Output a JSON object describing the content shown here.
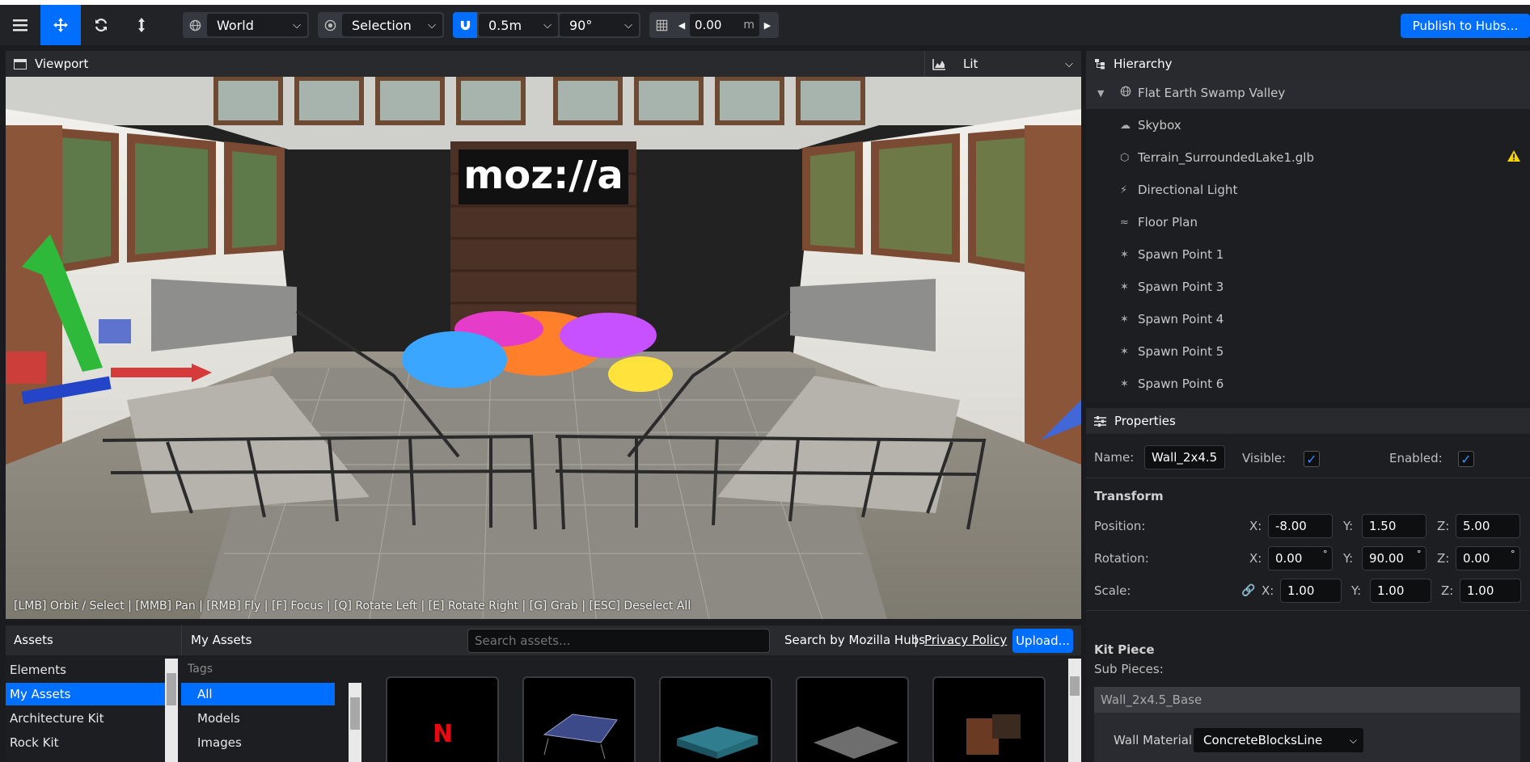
{
  "toolbar": {
    "coordinate_space": "World",
    "pivot_mode": "Selection",
    "snap_translate": "0.5m",
    "snap_rotate": "90°",
    "grid_height": "0.00",
    "grid_unit": "m",
    "publish_label": "Publish to Hubs..."
  },
  "viewport": {
    "title": "Viewport",
    "render_mode": "Lit",
    "logo_text": "moz://a",
    "hint": "[LMB] Orbit / Select | [MMB] Pan | [RMB] Fly | [F] Focus | [Q] Rotate Left | [E] Rotate Right | [G] Grab | [ESC] Deselect All"
  },
  "hierarchy": {
    "title": "Hierarchy",
    "items": [
      {
        "label": "Flat Earth Swamp Valley",
        "icon": "globe-icon"
      },
      {
        "label": "Skybox",
        "icon": "cloud-icon"
      },
      {
        "label": "Terrain_SurroundedLake1.glb",
        "icon": "cube-icon"
      },
      {
        "label": "Directional Light",
        "icon": "bolt-icon"
      },
      {
        "label": "Floor Plan",
        "icon": "shoe-prints-icon"
      },
      {
        "label": "Spawn Point 1",
        "icon": "street-view-icon"
      },
      {
        "label": "Spawn Point 3",
        "icon": "street-view-icon"
      },
      {
        "label": "Spawn Point 4",
        "icon": "street-view-icon"
      },
      {
        "label": "Spawn Point 5",
        "icon": "street-view-icon"
      },
      {
        "label": "Spawn Point 6",
        "icon": "street-view-icon"
      }
    ]
  },
  "properties": {
    "title": "Properties",
    "name_label": "Name:",
    "name_value": "Wall_2x4.5",
    "visible_label": "Visible:",
    "enabled_label": "Enabled:",
    "transform_title": "Transform",
    "position_label": "Position:",
    "rotation_label": "Rotation:",
    "scale_label": "Scale:",
    "x_label": "X:",
    "y_label": "Y:",
    "z_label": "Z:",
    "position": {
      "x": "-8.00",
      "y": "1.50",
      "z": "5.00"
    },
    "rotation": {
      "x": "0.00",
      "y": "90.00",
      "z": "0.00"
    },
    "scale": {
      "x": "1.00",
      "y": "1.00",
      "z": "1.00"
    },
    "kit_piece_title": "Kit Piece",
    "sub_pieces_label": "Sub Pieces:",
    "sub_piece": "Wall_2x4.5_Base",
    "wall_material_label": "Wall Material",
    "wall_material_value": "ConcreteBlocksLine"
  },
  "assets": {
    "title": "Assets",
    "section_title": "My Assets",
    "search_placeholder": "Search assets...",
    "search_by": "Search by Mozilla Hubs",
    "separator": "|",
    "privacy": "Privacy Policy",
    "upload": "Upload...",
    "categories": [
      "Elements",
      "My Assets",
      "Architecture Kit",
      "Rock Kit"
    ],
    "tags_title": "Tags",
    "tags": [
      "All",
      "Models",
      "Images"
    ],
    "thumb_logo": "N"
  },
  "colors": {
    "accent": "#006eff",
    "warning": "#f5d300"
  }
}
